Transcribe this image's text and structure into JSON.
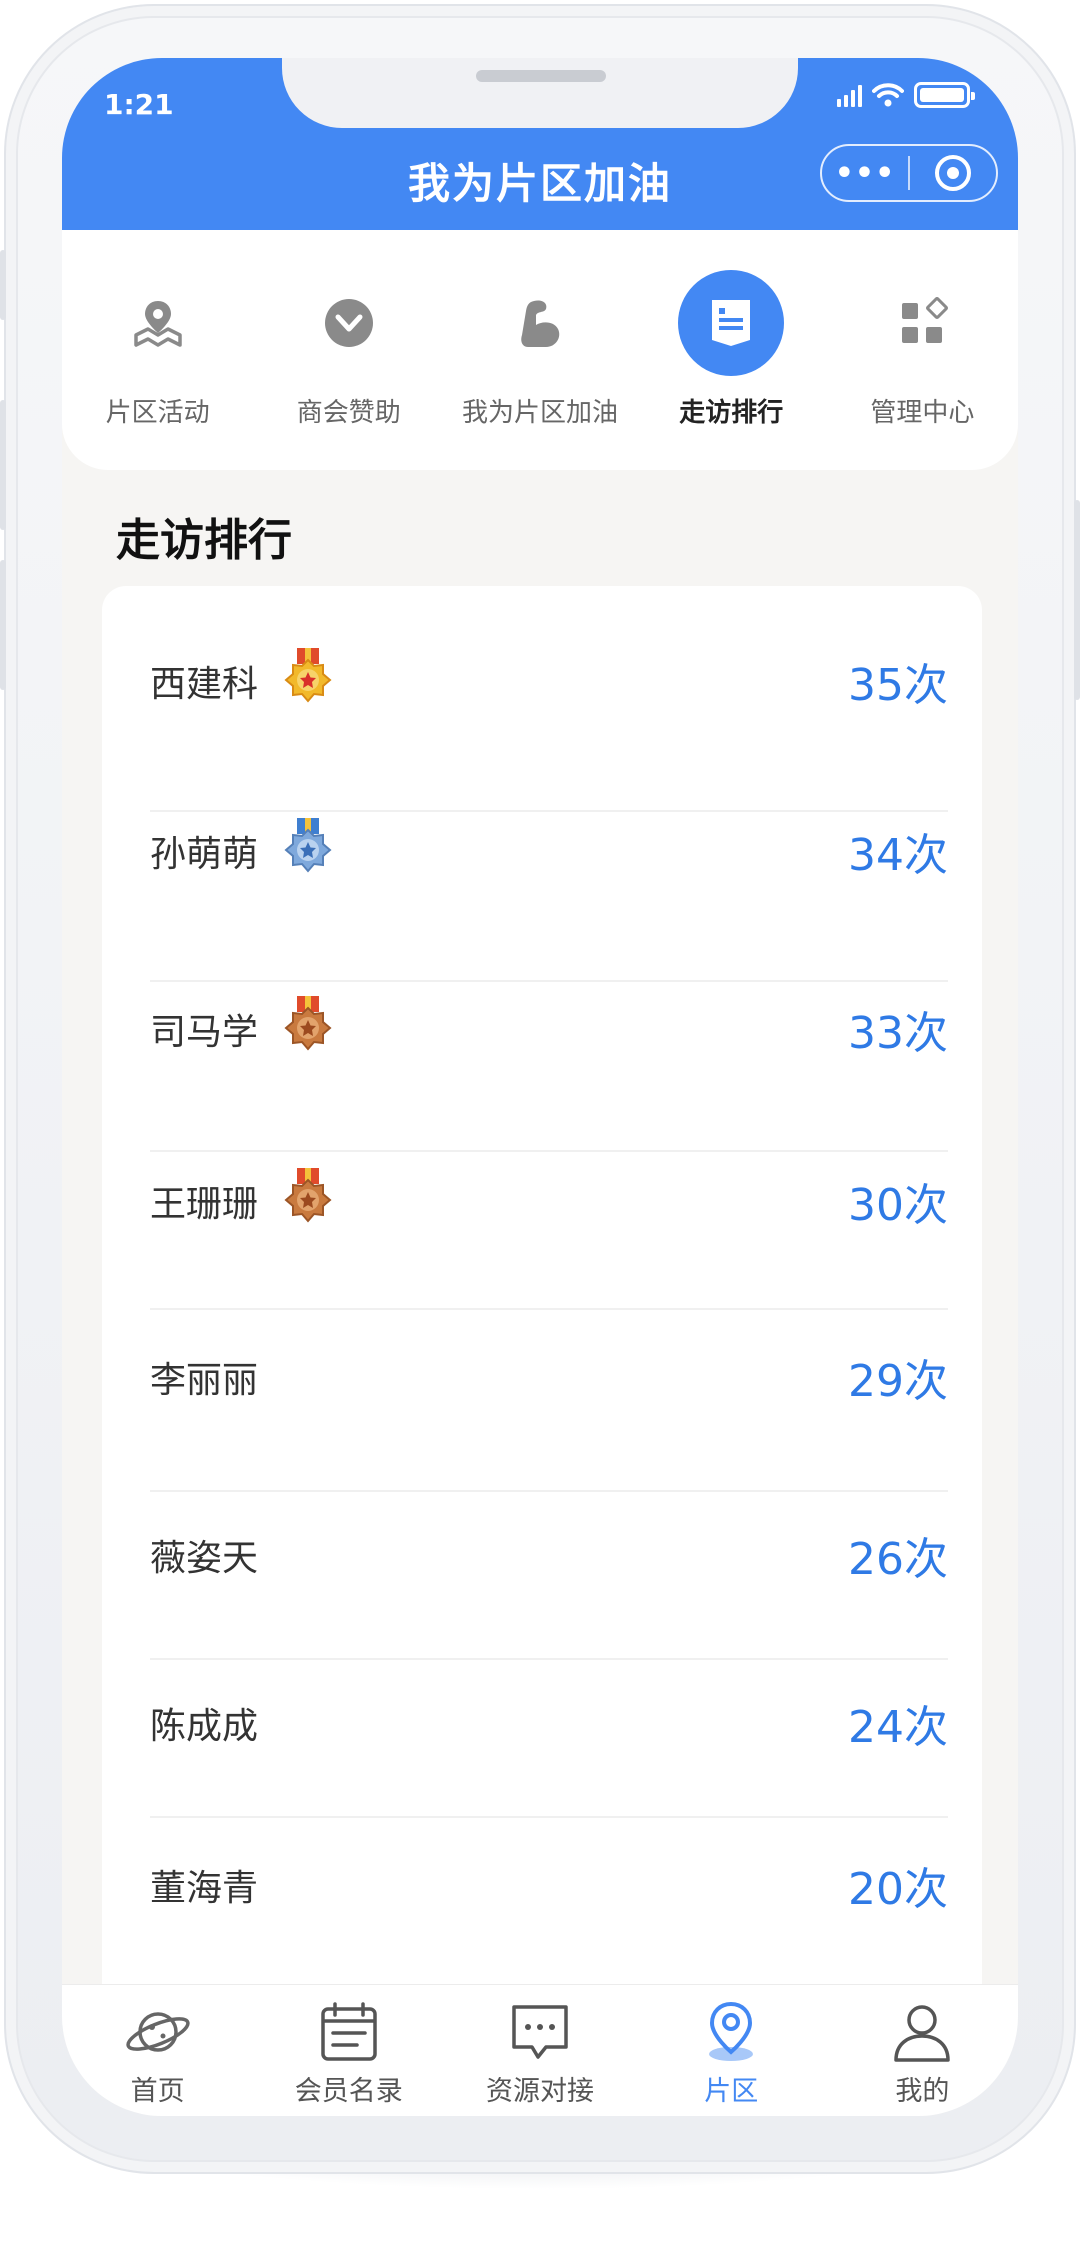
{
  "status": {
    "time": "1:21"
  },
  "header": {
    "title": "我为片区加油",
    "capsule_more": "•••"
  },
  "categories": [
    {
      "label": "片区活动",
      "icon": "map-pin-icon",
      "active": false
    },
    {
      "label": "商会赞助",
      "icon": "chevron-badge-icon",
      "active": false
    },
    {
      "label": "我为片区加油",
      "icon": "muscle-arm-icon",
      "active": false
    },
    {
      "label": "走访排行",
      "icon": "document-list-icon",
      "active": true
    },
    {
      "label": "管理中心",
      "icon": "grid-apps-icon",
      "active": false
    }
  ],
  "section": {
    "title": "走访排行"
  },
  "ranking": [
    {
      "name": "西建科",
      "count": "35次",
      "medal": "gold"
    },
    {
      "name": "孙萌萌",
      "count": "34次",
      "medal": "silver"
    },
    {
      "name": "司马学",
      "count": "33次",
      "medal": "bronze"
    },
    {
      "name": "王珊珊",
      "count": "30次",
      "medal": "bronze"
    },
    {
      "name": "李丽丽",
      "count": "29次",
      "medal": ""
    },
    {
      "name": "薇姿天",
      "count": "26次",
      "medal": ""
    },
    {
      "name": "陈成成",
      "count": "24次",
      "medal": ""
    },
    {
      "name": "董海青",
      "count": "20次",
      "medal": ""
    }
  ],
  "tabs": [
    {
      "label": "首页",
      "icon": "planet-icon",
      "active": false
    },
    {
      "label": "会员名录",
      "icon": "calendar-list-icon",
      "active": false
    },
    {
      "label": "资源对接",
      "icon": "chat-bubble-icon",
      "active": false
    },
    {
      "label": "片区",
      "icon": "location-pin-icon",
      "active": true
    },
    {
      "label": "我的",
      "icon": "user-icon",
      "active": false
    }
  ],
  "colors": {
    "primary": "#4388f3",
    "count": "#2f7ae5",
    "gold": "#e8a21d",
    "silver": "#6f9fd6",
    "bronze": "#c0703a"
  }
}
